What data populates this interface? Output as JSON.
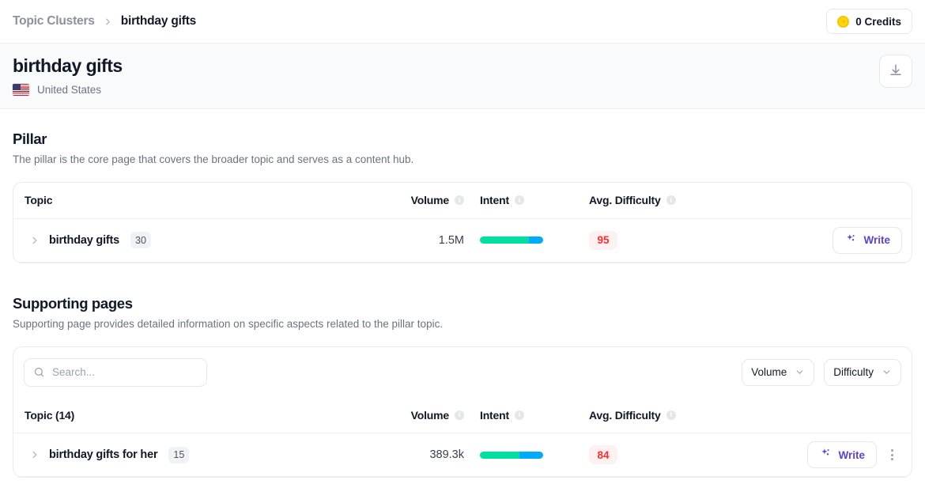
{
  "breadcrumb": {
    "root": "Topic Clusters",
    "separator_icon": "chevron-right-icon",
    "current": "birthday gifts"
  },
  "credits": {
    "label": "0 Credits",
    "icon": "coin-icon",
    "color": "#ffd60a"
  },
  "header": {
    "title": "birthday gifts",
    "locale": "United States",
    "flag_icon": "us-flag-icon",
    "export_icon": "download-icon"
  },
  "pillar": {
    "heading": "Pillar",
    "description": "The pillar is the core page that covers the broader topic and serves as a content hub.",
    "columns": [
      {
        "label": "Topic",
        "info": false
      },
      {
        "label": "Volume",
        "info": true
      },
      {
        "label": "Intent",
        "info": true
      },
      {
        "label": "Avg. Difficulty",
        "info": true
      }
    ],
    "rows": [
      {
        "topic": "birthday gifts",
        "count": "30",
        "volume": "1.5M",
        "intent": {
          "segments": [
            {
              "name": "informational",
              "pct": 78,
              "color": "#00e0a0"
            },
            {
              "name": "commercial",
              "pct": 22,
              "color": "#00aaff"
            }
          ]
        },
        "difficulty": "95",
        "difficulty_color": "#ff2d2d",
        "difficulty_bg": "#fff1f1",
        "action_label": "Write",
        "action_icon": "sparkle-icon"
      }
    ]
  },
  "supporting": {
    "heading": "Supporting pages",
    "description": "Supporting page provides detailed information on specific aspects related to the pillar topic.",
    "search": {
      "placeholder": "Search...",
      "value": "",
      "icon": "search-icon"
    },
    "filters": [
      {
        "label": "Volume",
        "icon": "chevron-down-icon"
      },
      {
        "label": "Difficulty",
        "icon": "chevron-down-icon"
      }
    ],
    "columns": [
      {
        "label": "Topic (14)",
        "info": false
      },
      {
        "label": "Volume",
        "info": true
      },
      {
        "label": "Intent",
        "info": true
      },
      {
        "label": "Avg. Difficulty",
        "info": true
      }
    ],
    "rows": [
      {
        "topic": "birthday gifts for her",
        "count": "15",
        "volume": "389.3k",
        "intent": {
          "segments": [
            {
              "name": "informational",
              "pct": 62,
              "color": "#00e0a0"
            },
            {
              "name": "commercial",
              "pct": 38,
              "color": "#00aaff"
            }
          ]
        },
        "difficulty": "84",
        "difficulty_color": "#ff2d2d",
        "difficulty_bg": "#fff1f1",
        "action_label": "Write",
        "action_icon": "sparkle-icon",
        "menu_icon": "kebab-menu-icon"
      }
    ]
  }
}
